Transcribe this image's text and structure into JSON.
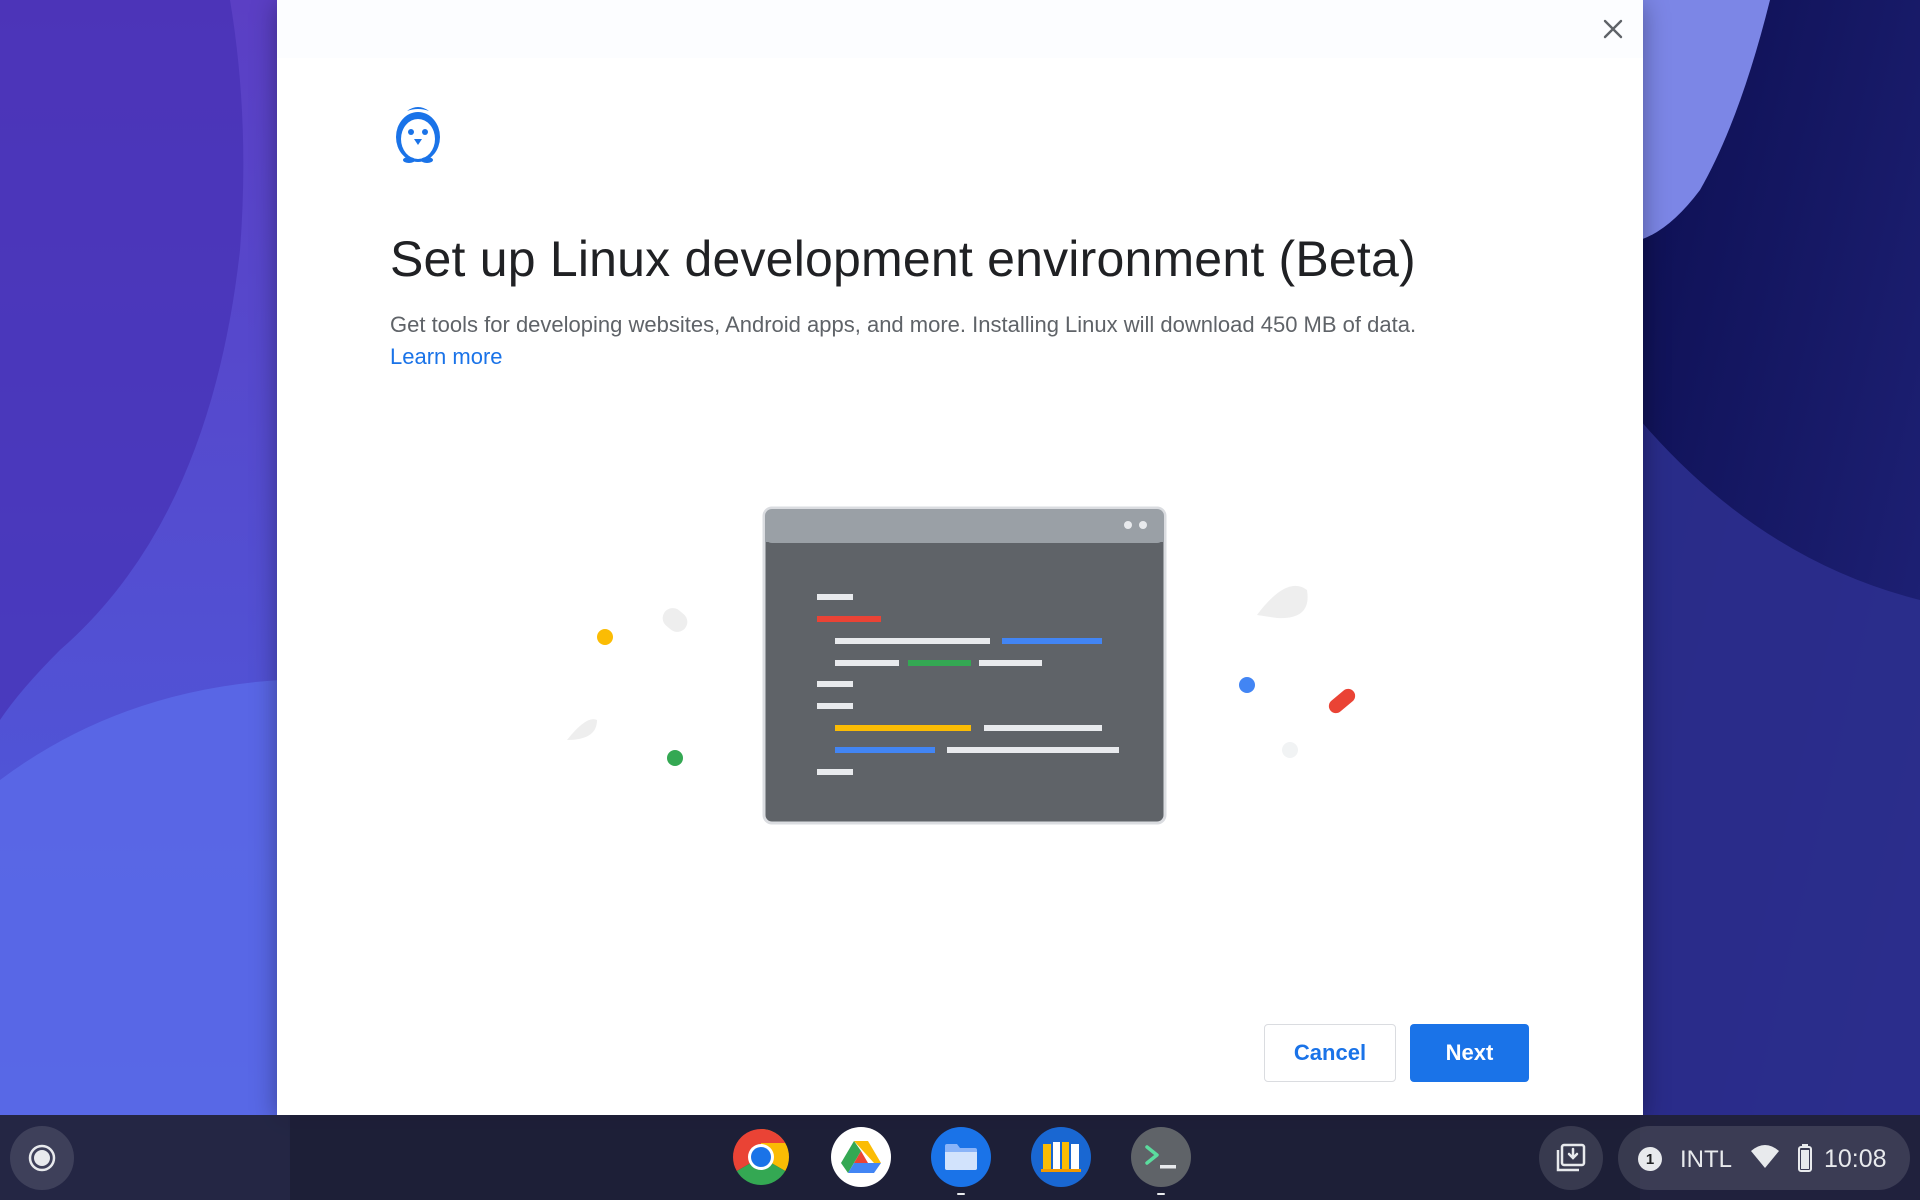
{
  "dialog": {
    "title": "Set up Linux development environment (Beta)",
    "description": "Get tools for developing websites, Android apps, and more. Installing Linux will download 450 MB of data.",
    "learn_more": "Learn more",
    "cancel_label": "Cancel",
    "next_label": "Next",
    "icon": "penguin-icon",
    "close_icon": "close-icon"
  },
  "shelf": {
    "launcher_icon": "launcher-icon",
    "apps": [
      {
        "name": "Chrome",
        "icon": "chrome-icon"
      },
      {
        "name": "Google Drive",
        "icon": "drive-icon"
      },
      {
        "name": "Files",
        "icon": "files-icon"
      },
      {
        "name": "Books",
        "icon": "books-icon"
      },
      {
        "name": "Terminal",
        "icon": "terminal-icon"
      }
    ],
    "holding_space_icon": "holding-space-icon",
    "notification_count": "1",
    "ime": "INTL",
    "time": "10:08"
  },
  "colors": {
    "accent": "#1a73e8",
    "title_text": "#202124",
    "body_text": "#5f6368",
    "shelf": "#202136"
  }
}
